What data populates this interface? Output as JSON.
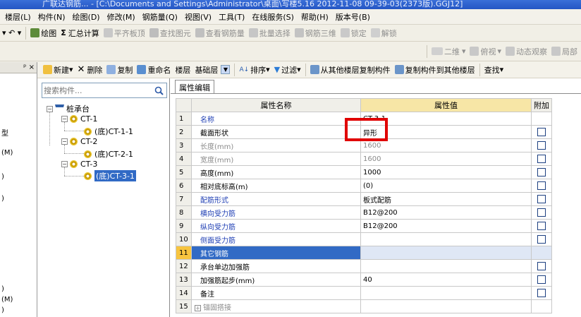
{
  "window_title": "   广联达钢筋... - [C:\\Documents and Settings\\Administrator\\桌面\\写楼5.16 2012-11-08 09-39-03(2373版).GGJ12]",
  "menu": [
    "楼层(L)",
    "构件(N)",
    "绘图(D)",
    "修改(M)",
    "钢筋量(Q)",
    "视图(V)",
    "工具(T)",
    "在线服务(S)",
    "帮助(H)",
    "版本号(B)"
  ],
  "toolbar1": {
    "undo": "▾ ↶ ▾",
    "draw": "绘图",
    "sum_calc": "汇总计算",
    "flat_slab": "平齐板顶",
    "find_elem": "查找图元",
    "view_rebar": "查看钢筋量",
    "batch_select": "批量选择",
    "rebar_3d": "钢筋三维",
    "lock": "锁定",
    "unlock": "解锁"
  },
  "toolbar2": {
    "view2d": "二维",
    "perspective": "俯视",
    "dynamic_view": "动态观察",
    "local": "局部"
  },
  "toolbar3": {
    "new": "新建",
    "delete": "删除",
    "copy": "复制",
    "rename": "重命名",
    "floor_label": "楼层",
    "floor_value": "基础层",
    "sort": "排序",
    "filter": "过滤",
    "copy_from_other": "从其他楼层复制构件",
    "copy_to_other": "复制构件到其他楼层",
    "find": "查找"
  },
  "left_panel": {
    "pin": "ᵖ ×",
    "rows": [
      "型",
      "(M)",
      ")",
      ")",
      ")",
      "(M)",
      ")"
    ]
  },
  "tree": {
    "search_placeholder": "搜索构件...",
    "root": "桩承台",
    "nodes": [
      {
        "label": "CT-1",
        "child": "(底)CT-1-1"
      },
      {
        "label": "CT-2",
        "child": "(底)CT-2-1"
      },
      {
        "label": "CT-3",
        "child": "(底)CT-3-1"
      }
    ]
  },
  "prop_tab": "属性编辑",
  "prop_headers": {
    "name": "属性名称",
    "value": "属性值",
    "extra": "附加"
  },
  "props": [
    {
      "n": "1",
      "name": "名称",
      "value": "CT-3-1",
      "style": "blue",
      "chk": false
    },
    {
      "n": "2",
      "name": "截面形状",
      "value": "异形",
      "style": "",
      "chk": true
    },
    {
      "n": "3",
      "name": "长度(mm)",
      "value": "1600",
      "style": "gray",
      "chk": true
    },
    {
      "n": "4",
      "name": "宽度(mm)",
      "value": "1600",
      "style": "gray",
      "chk": true
    },
    {
      "n": "5",
      "name": "高度(mm)",
      "value": "1000",
      "style": "",
      "chk": true
    },
    {
      "n": "6",
      "name": "相对底标高(m)",
      "value": "(0)",
      "style": "",
      "chk": true
    },
    {
      "n": "7",
      "name": "配筋形式",
      "value": "板式配筋",
      "style": "blue",
      "chk": true
    },
    {
      "n": "8",
      "name": "横向受力筋",
      "value": "B12@200",
      "style": "blue",
      "chk": true
    },
    {
      "n": "9",
      "name": "纵向受力筋",
      "value": "B12@200",
      "style": "blue",
      "chk": true
    },
    {
      "n": "10",
      "name": "侧面受力筋",
      "value": "",
      "style": "blue",
      "chk": true
    },
    {
      "n": "11",
      "name": "其它钢筋",
      "value": "",
      "style": "sel",
      "chk": false
    },
    {
      "n": "12",
      "name": "承台单边加强筋",
      "value": "",
      "style": "",
      "chk": true
    },
    {
      "n": "13",
      "name": "加强筋起步(mm)",
      "value": "40",
      "style": "",
      "chk": true
    },
    {
      "n": "14",
      "name": "备注",
      "value": "",
      "style": "",
      "chk": true
    },
    {
      "n": "15",
      "name": "锚固搭接",
      "value": "",
      "style": "gray",
      "chk": false,
      "expand": true
    }
  ],
  "colors": {
    "selection": "#316ac5",
    "highlight_box": "#e00000",
    "title_bar": "#2456c4"
  }
}
